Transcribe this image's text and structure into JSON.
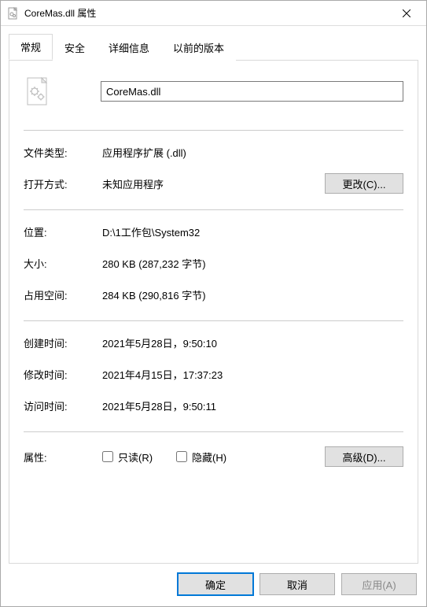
{
  "window": {
    "title": "CoreMas.dll 属性"
  },
  "tabs": {
    "general": "常规",
    "security": "安全",
    "details": "详细信息",
    "previous": "以前的版本"
  },
  "general": {
    "filename": "CoreMas.dll",
    "labels": {
      "filetype": "文件类型:",
      "openwith": "打开方式:",
      "location": "位置:",
      "size": "大小:",
      "sizeondisk": "占用空间:",
      "created": "创建时间:",
      "modified": "修改时间:",
      "accessed": "访问时间:",
      "attributes": "属性:"
    },
    "values": {
      "filetype": "应用程序扩展 (.dll)",
      "openwith": "未知应用程序",
      "location": "D:\\1工作包\\System32",
      "size": "280 KB (287,232 字节)",
      "sizeondisk": "284 KB (290,816 字节)",
      "created": "2021年5月28日，9:50:10",
      "modified": "2021年4月15日，17:37:23",
      "accessed": "2021年5月28日，9:50:11"
    },
    "buttons": {
      "change": "更改(C)...",
      "advanced": "高级(D)..."
    },
    "checkboxes": {
      "readonly": "只读(R)",
      "hidden": "隐藏(H)"
    }
  },
  "footer": {
    "ok": "确定",
    "cancel": "取消",
    "apply": "应用(A)"
  }
}
